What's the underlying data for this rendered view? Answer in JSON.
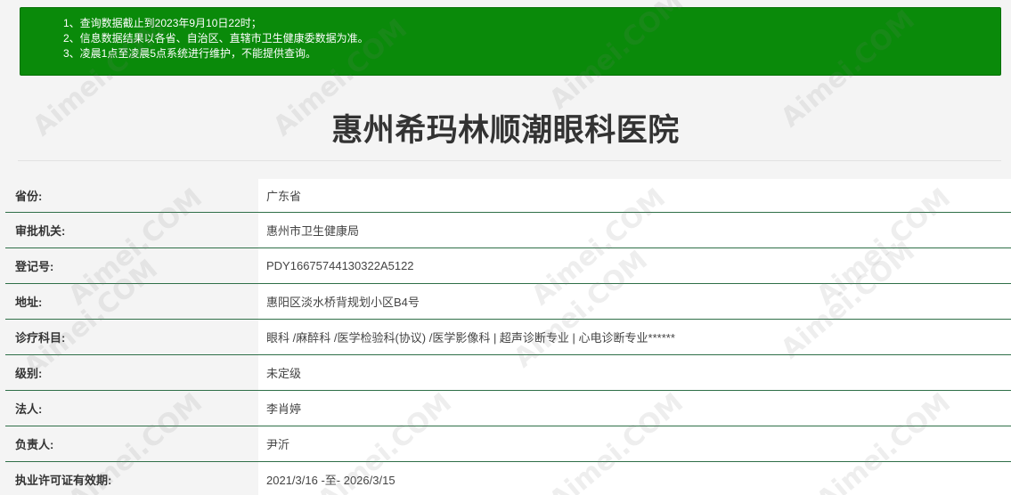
{
  "notice": {
    "lines": [
      "1、查询数据截止到2023年9月10日22时；",
      "2、信息数据结果以各省、自治区、直辖市卫生健康委数据为准。",
      "3、凌晨1点至凌晨5点系统进行维护，不能提供查询。"
    ]
  },
  "hospital": {
    "name": "惠州希玛林顺潮眼科医院"
  },
  "details": [
    {
      "label": "省份:",
      "value": "广东省"
    },
    {
      "label": "审批机关:",
      "value": "惠州市卫生健康局"
    },
    {
      "label": "登记号:",
      "value": "PDY16675744130322A5122"
    },
    {
      "label": "地址:",
      "value": "惠阳区淡水桥背规划小区B4号"
    },
    {
      "label": "诊疗科目:",
      "value": "眼科 /麻醉科 /医学检验科(协议) /医学影像科  |  超声诊断专业  |  心电诊断专业******"
    },
    {
      "label": "级别:",
      "value": "未定级"
    },
    {
      "label": "法人:",
      "value": "李肖婷"
    },
    {
      "label": "负责人:",
      "value": "尹沂"
    },
    {
      "label": "执业许可证有效期:",
      "value": "2021/3/16 -至- 2026/3/15"
    }
  ],
  "watermark": "Aimei.COM"
}
